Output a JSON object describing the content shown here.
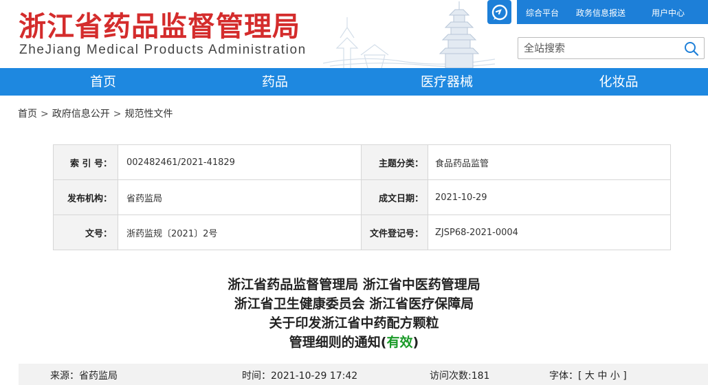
{
  "header": {
    "logo_cn": "浙江省药品监督管理局",
    "logo_en": "ZheJiang Medical Products Administration",
    "service_icon": "chat-service-icon",
    "top_links": [
      "综合平台",
      "政务信息报送",
      "用户中心"
    ],
    "search_placeholder": "全站搜索",
    "accent_color": "#1d7fd8",
    "brand_color": "#d42c2c"
  },
  "nav": {
    "items": [
      "首页",
      "药品",
      "医疗器械",
      "化妆品"
    ],
    "color": "#1e88e0"
  },
  "breadcrumb": {
    "items": [
      "首页",
      "政府信息公开",
      "规范性文件"
    ],
    "separator": ">"
  },
  "info": {
    "index_label": "索 引 号：",
    "index_value": "002482461/2021-41829",
    "topic_label": "主题分类：",
    "topic_value": "食品药品监管",
    "publisher_label": "发布机构：",
    "publisher_value": "省药监局",
    "date_label": "成文日期：",
    "date_value": "2021-10-29",
    "docno_label": "文号：",
    "docno_value": "浙药监规〔2021〕2号",
    "reg_label": "文件登记号：",
    "reg_value": "ZJSP68-2021-0004"
  },
  "title": {
    "line1": "浙江省药品监督管理局 浙江省中医药管理局",
    "line2": "浙江省卫生健康委员会 浙江省医疗保障局",
    "line3": "关于印发浙江省中药配方颗粒",
    "line4_prefix": "管理细则的通知(",
    "line4_status": "有效",
    "line4_suffix": ")",
    "status_color": "#1a9a28"
  },
  "meta": {
    "source": "来源：省药监局",
    "time": "时间：2021-10-29 17:42",
    "visits": "访问次数:181",
    "font_size": "字体：[ 大 中 小 ]"
  }
}
